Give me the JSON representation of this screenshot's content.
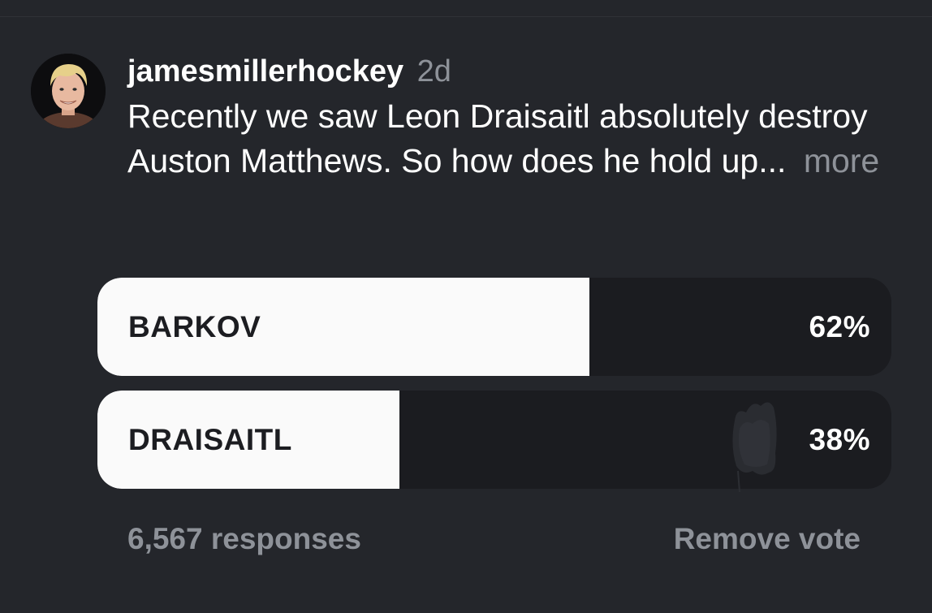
{
  "post": {
    "username": "jamesmillerhockey",
    "time": "2d",
    "text": "Recently we saw Leon Draisaitl absolutely destroy Auston Matthews. So how does he hold up...",
    "more_label": "more"
  },
  "poll": {
    "options": [
      {
        "label": "BARKOV",
        "percent_text": "62%",
        "percent": 62
      },
      {
        "label": "DRAISAITL",
        "percent_text": "38%",
        "percent": 38
      }
    ],
    "responses": "6,567 responses",
    "remove_vote_label": "Remove vote"
  },
  "colors": {
    "background": "#24262b",
    "poll_track": "#1b1c20",
    "poll_fill": "#fafafa",
    "muted_text": "#8e9299"
  }
}
